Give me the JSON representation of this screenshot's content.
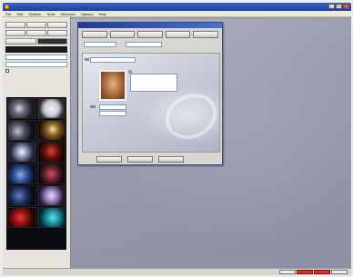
{
  "titlebar": {
    "title": ""
  },
  "menubar": {
    "items": [
      "File",
      "Edit",
      "Options",
      "Tools",
      "Windows",
      "Options",
      "Help"
    ]
  },
  "left": {
    "tools": [
      "",
      "",
      "",
      "",
      "",
      ""
    ],
    "tool_row3": [
      "",
      ""
    ],
    "field1": "",
    "field2": "",
    "checkbox_label": "",
    "thumb_title": ""
  },
  "dialog": {
    "title": "",
    "toolbar": [
      "",
      "",
      "",
      "",
      ""
    ],
    "row_label1": "",
    "row_input1": "",
    "row_label2": "",
    "row_input2": "",
    "name_input": "",
    "description": "",
    "title_field": "",
    "footer": [
      "",
      "",
      ""
    ]
  },
  "status": {
    "text": ""
  },
  "icons": {
    "close": "close-icon",
    "minimize": "minimize-icon",
    "maximize": "maximize-icon",
    "app": "app-icon"
  }
}
